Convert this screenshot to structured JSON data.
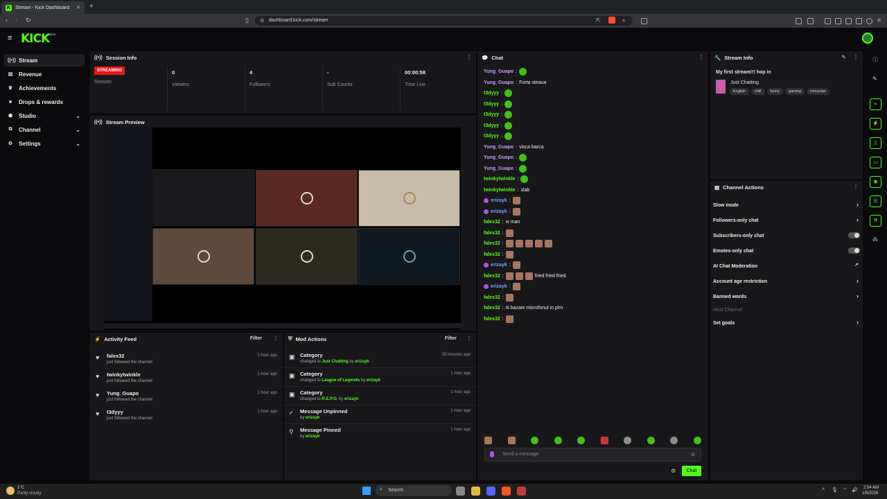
{
  "browser": {
    "tab_title": "Stream - Kick Dashboard",
    "tab_close": "✕",
    "new_tab": "+",
    "url": "dashboard.kick.com/stream"
  },
  "header": {
    "logo": "KICK",
    "beta": "BETA"
  },
  "sidebar": {
    "items": [
      {
        "label": "Stream",
        "icon": "broadcast-icon"
      },
      {
        "label": "Revenue",
        "icon": "revenue-icon"
      },
      {
        "label": "Achievements",
        "icon": "trophy-icon"
      },
      {
        "label": "Drops & rewards",
        "icon": "gift-icon"
      },
      {
        "label": "Studio",
        "icon": "studio-icon"
      },
      {
        "label": "Channel",
        "icon": "channel-icon"
      },
      {
        "label": "Settings",
        "icon": "gear-icon"
      }
    ]
  },
  "session": {
    "title": "Session Info",
    "status": "STREAMING",
    "session_label": "Session",
    "viewers_value": "0",
    "viewers_label": "Viewers",
    "followers_value": "4",
    "followers_label": "Followers",
    "subs_value": "-",
    "subs_label": "Sub Counts",
    "time_value": "00:00:58",
    "time_label": "Time Live"
  },
  "preview": {
    "title": "Stream Preview"
  },
  "activity": {
    "title": "Activity Feed",
    "filter": "Filter",
    "items": [
      {
        "name": "falex32",
        "sub": "just followed the channel",
        "time": "1 hour ago"
      },
      {
        "name": "twinkytwinkle",
        "sub": "just followed the channel",
        "time": "1 hour ago"
      },
      {
        "name": "Yung_Guapo",
        "sub": "just followed the channel",
        "time": "1 hour ago"
      },
      {
        "name": "t3dyyy",
        "sub": "just followed the channel",
        "time": "1 hour ago"
      }
    ]
  },
  "mod": {
    "title": "Mod Actions",
    "filter": "Filter",
    "items": [
      {
        "name": "Category",
        "pre": "changed to",
        "target": "Just Chatting",
        "by": "by",
        "user": "erizayk",
        "time": "55 minutes ago"
      },
      {
        "name": "Category",
        "pre": "changed to",
        "target": "League of Legends",
        "by": "by",
        "user": "erizayk",
        "time": "1 hour ago"
      },
      {
        "name": "Category",
        "pre": "changed to",
        "target": "R.E.P.O.",
        "by": "by",
        "user": "erizayk",
        "time": "1 hour ago"
      },
      {
        "name": "Message Unpinned",
        "pre": "",
        "target": "",
        "by": "by",
        "user": "erizayk",
        "time": "1 hour ago"
      },
      {
        "name": "Message Pinned",
        "pre": "",
        "target": "",
        "by": "by",
        "user": "erizayk",
        "time": "1 hour ago"
      }
    ]
  },
  "chat": {
    "title": "Chat",
    "messages": [
      {
        "user": "Yung_Guapo",
        "color": "#c89cff",
        "text": "",
        "emotes": 1
      },
      {
        "user": "Yung_Guapo",
        "color": "#c89cff",
        "text": "Forta steaua",
        "emotes": 0
      },
      {
        "user": "t3dyyy",
        "color": "#53fc18",
        "text": "",
        "emotes": 1
      },
      {
        "user": "t3dyyy",
        "color": "#53fc18",
        "text": "",
        "emotes": 1
      },
      {
        "user": "t3dyyy",
        "color": "#53fc18",
        "text": "",
        "emotes": 1
      },
      {
        "user": "t3dyyy",
        "color": "#53fc18",
        "text": "",
        "emotes": 1
      },
      {
        "user": "t3dyyy",
        "color": "#53fc18",
        "text": "",
        "emotes": 1
      },
      {
        "user": "Yung_Guapo",
        "color": "#c89cff",
        "text": "visca barca",
        "emotes": 0
      },
      {
        "user": "Yung_Guapo",
        "color": "#c89cff",
        "text": "",
        "emotes": 1
      },
      {
        "user": "Yung_Guapo",
        "color": "#c89cff",
        "text": "",
        "emotes": 1
      },
      {
        "user": "twinkytwinkle",
        "color": "#53fc18",
        "text": "",
        "emotes": 1
      },
      {
        "user": "twinkytwinkle",
        "color": "#53fc18",
        "text": "slab",
        "emotes": 0
      },
      {
        "user": "erizayk",
        "color": "#7aa2ff",
        "text": "",
        "emotes": 1,
        "badge": true
      },
      {
        "user": "erizayk",
        "color": "#7aa2ff",
        "text": "",
        "emotes": 1,
        "badge": true
      },
      {
        "user": "falex32",
        "color": "#53fc18",
        "text": "w man",
        "emotes": 0
      },
      {
        "user": "falex32",
        "color": "#53fc18",
        "text": "",
        "emotes": 1
      },
      {
        "user": "falex32",
        "color": "#53fc18",
        "text": "",
        "emotes": 5
      },
      {
        "user": "falex32",
        "color": "#53fc18",
        "text": "",
        "emotes": 1
      },
      {
        "user": "erizayk",
        "color": "#7aa2ff",
        "text": "",
        "emotes": 1,
        "badge": true
      },
      {
        "user": "falex32",
        "color": "#53fc18",
        "text": "fried fried fried",
        "emotes": 3
      },
      {
        "user": "erizayk",
        "color": "#7aa2ff",
        "text": "",
        "emotes": 1,
        "badge": true
      },
      {
        "user": "falex32",
        "color": "#53fc18",
        "text": "",
        "emotes": 1
      },
      {
        "user": "falex32",
        "color": "#53fc18",
        "text": "iti bazaie microfonul in plm",
        "emotes": 0
      },
      {
        "user": "falex32",
        "color": "#53fc18",
        "text": "",
        "emotes": 1
      }
    ],
    "placeholder": "Send a message",
    "send": "Chat"
  },
  "stream_info": {
    "title": "Stream Info",
    "stream_title": "My first stream!!! hop in",
    "category": "Just Chatting",
    "tags": [
      "English",
      "chill",
      "funny",
      "gaming",
      "romanian"
    ]
  },
  "channel_actions": {
    "title": "Channel Actions",
    "items": [
      {
        "label": "Slow mode",
        "kind": "arrow"
      },
      {
        "label": "Followers-only chat",
        "kind": "arrow"
      },
      {
        "label": "Subscribers-only chat",
        "kind": "toggle"
      },
      {
        "label": "Emotes-only chat",
        "kind": "toggle"
      },
      {
        "label": "AI Chat Moderation",
        "kind": "external"
      },
      {
        "label": "Account age restriction",
        "kind": "arrow"
      },
      {
        "label": "Banned words",
        "kind": "arrow"
      },
      {
        "label": "Host Channel",
        "kind": "disabled"
      },
      {
        "label": "Set goals",
        "kind": "arrow"
      }
    ]
  },
  "taskbar": {
    "weather_temp": "1°C",
    "weather_desc": "Partly cloudy",
    "search": "Search",
    "time": "2:54 AM",
    "date": "1/5/2026"
  },
  "colors": {
    "accent": "#53fc18",
    "live": "#e91916",
    "panel": "#18181b"
  }
}
